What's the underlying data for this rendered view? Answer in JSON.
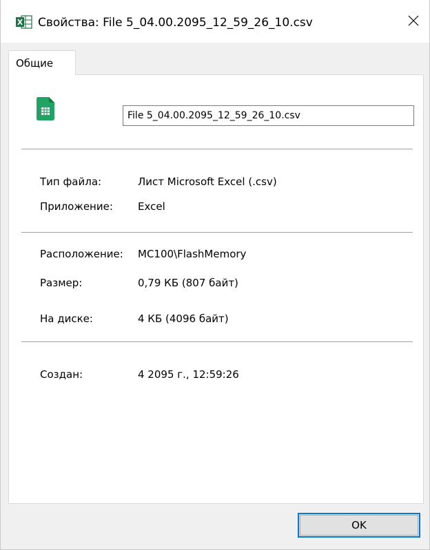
{
  "window": {
    "title": "Свойства: File 5_04.00.2095_12_59_26_10.csv",
    "title_icon": "excel-icon",
    "close_icon": "close-icon"
  },
  "tabs": [
    {
      "label": "Общие",
      "active": true
    }
  ],
  "general": {
    "file_icon": "sheets-file-icon",
    "file_name": "File 5_04.00.2095_12_59_26_10.csv",
    "file_type_label": "Тип файла:",
    "file_type_value": "Лист Microsoft Excel (.csv)",
    "app_label": "Приложение:",
    "app_value": "Excel",
    "location_label": "Расположение:",
    "location_value": "MC100\\FlashMemory",
    "size_label": "Размер:",
    "size_value": "0,79 КБ (807 байт)",
    "disk_label": "На диске:",
    "disk_value": "4 КБ (4096 байт)",
    "created_label": "Создан:",
    "created_value": "4  2095 г., 12:59:26"
  },
  "buttons": {
    "ok_label": "OK"
  },
  "colors": {
    "accent": "#0078d7",
    "excel_green": "#1e7145",
    "sheets_green": "#21a366"
  }
}
